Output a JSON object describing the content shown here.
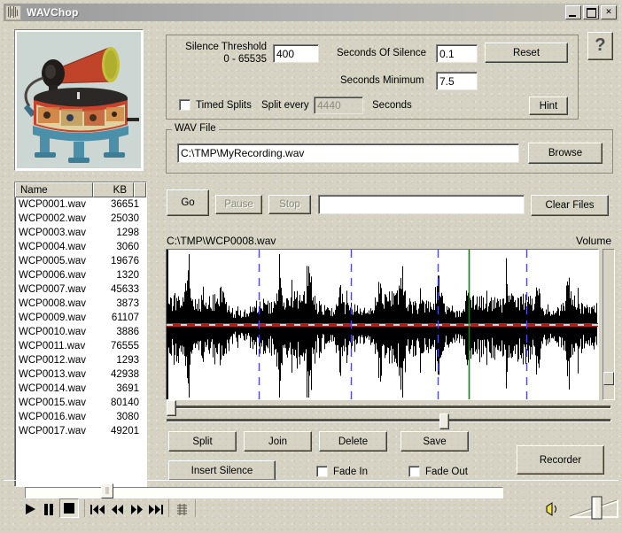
{
  "window": {
    "title": "WAVChop",
    "icon": "waveform-icon",
    "minimize_label": "_",
    "maximize_label": "□",
    "close_label": "✕"
  },
  "help_button": {
    "label": "?"
  },
  "settings": {
    "silence_threshold_label": "Silence Threshold",
    "silence_threshold_range": "0 - 65535",
    "silence_threshold_value": "400",
    "seconds_of_silence_label": "Seconds Of Silence",
    "seconds_of_silence_value": "0.1",
    "seconds_minimum_label": "Seconds Minimum",
    "seconds_minimum_value": "7.5",
    "reset_label": "Reset",
    "hint_label": "Hint",
    "timed_splits_label": "Timed Splits",
    "timed_splits_checked": false,
    "split_every_label": "Split every",
    "split_every_value": "4440",
    "split_every_enabled": false,
    "seconds_label": "Seconds"
  },
  "wav_file": {
    "group_title": "WAV File",
    "path_value": "C:\\TMP\\MyRecording.wav",
    "browse_label": "Browse"
  },
  "transport_row": {
    "go_label": "Go",
    "pause_label": "Pause",
    "pause_enabled": false,
    "stop_label": "Stop",
    "stop_enabled": false,
    "progress_value": "",
    "clear_files_label": "Clear Files"
  },
  "file_list": {
    "columns": [
      "Name",
      "KB",
      ""
    ],
    "rows": [
      {
        "name": "WCP0001.wav",
        "kb": "36651"
      },
      {
        "name": "WCP0002.wav",
        "kb": "25030"
      },
      {
        "name": "WCP0003.wav",
        "kb": "1298"
      },
      {
        "name": "WCP0004.wav",
        "kb": "3060"
      },
      {
        "name": "WCP0005.wav",
        "kb": "19676"
      },
      {
        "name": "WCP0006.wav",
        "kb": "1320"
      },
      {
        "name": "WCP0007.wav",
        "kb": "45633"
      },
      {
        "name": "WCP0008.wav",
        "kb": "3873"
      },
      {
        "name": "WCP0009.wav",
        "kb": "61107"
      },
      {
        "name": "WCP0010.wav",
        "kb": "3886"
      },
      {
        "name": "WCP0011.wav",
        "kb": "76555"
      },
      {
        "name": "WCP0012.wav",
        "kb": "1293"
      },
      {
        "name": "WCP0013.wav",
        "kb": "42938"
      },
      {
        "name": "WCP0014.wav",
        "kb": "3691"
      },
      {
        "name": "WCP0015.wav",
        "kb": "80140"
      },
      {
        "name": "WCP0016.wav",
        "kb": "3080"
      },
      {
        "name": "WCP0017.wav",
        "kb": "49201"
      }
    ]
  },
  "waveform": {
    "file_label": "C:\\TMP\\WCP0008.wav",
    "volume_label": "Volume",
    "center_line_color": "#b41e1e",
    "split_marker_color": "#4b4bdc",
    "cursor_marker_color": "#009000",
    "waveform_color": "#000000",
    "split_markers_pct": [
      21.3,
      42.8,
      62.8,
      83.4
    ],
    "cursor_marker_pct": 70.1
  },
  "edit_buttons": {
    "split_label": "Split",
    "join_label": "Join",
    "delete_label": "Delete",
    "save_label": "Save",
    "insert_silence_label": "Insert Silence",
    "fade_in_label": "Fade In",
    "fade_in_checked": false,
    "fade_out_label": "Fade Out",
    "fade_out_checked": false,
    "recorder_label": "Recorder"
  },
  "player": {
    "play_icon": "play-icon",
    "pause_icon": "pause-icon",
    "stop_icon": "stop-icon",
    "prev_track_icon": "skip-back-icon",
    "rewind_icon": "rewind-icon",
    "forward_icon": "fast-forward-icon",
    "next_track_icon": "skip-forward-icon",
    "playlist_icon": "playlist-icon",
    "volume_icon": "speaker-icon",
    "position_pct": 16,
    "volume_pct": 60
  }
}
